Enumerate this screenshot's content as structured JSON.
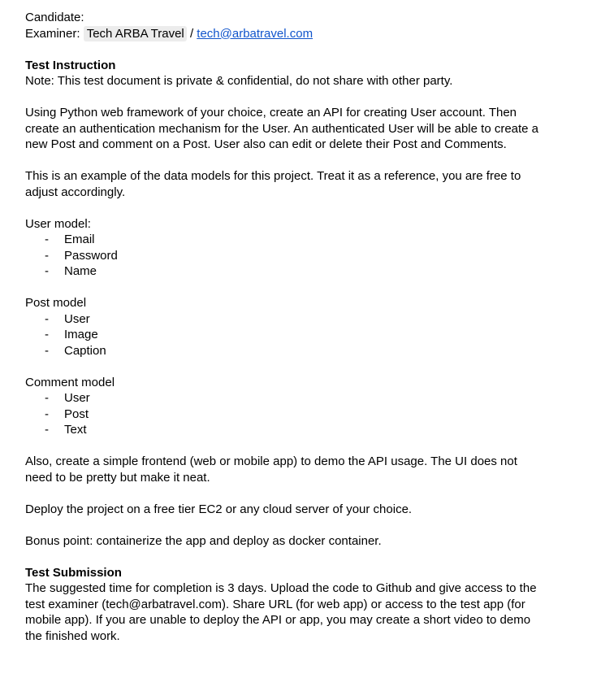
{
  "header": {
    "candidate_label": "Candidate:",
    "examiner_label": "Examiner:",
    "examiner_name": "Tech ARBA Travel",
    "separator": "/",
    "examiner_email": "tech@arbatravel.com"
  },
  "instruction": {
    "heading": "Test Instruction",
    "note": "Note: This test document is private & confidential, do not share with other party.",
    "intro": "Using Python web framework of your choice, create an API for creating User account. Then create an authentication mechanism for the User. An authenticated User will be able to create a new Post and comment on a Post. User also can edit or delete their Post and Comments.",
    "models_intro": "This is an example of the data models for this project. Treat it as a reference, you are free to adjust accordingly."
  },
  "models": [
    {
      "title": "User model:",
      "fields": [
        "Email",
        "Password",
        "Name"
      ]
    },
    {
      "title": "Post model",
      "fields": [
        "User",
        "Image",
        "Caption"
      ]
    },
    {
      "title": "Comment model",
      "fields": [
        "User",
        "Post",
        "Text"
      ]
    }
  ],
  "bullet_char": "-",
  "requirements": {
    "frontend": "Also, create a simple frontend (web or mobile app) to demo the API usage. The UI does not need to be pretty but make it neat.",
    "deploy": "Deploy the project on a free tier EC2 or any cloud server of your choice.",
    "bonus": "Bonus point: containerize the app and deploy as docker container."
  },
  "submission": {
    "heading": "Test Submission",
    "body": "The suggested time for completion is 3 days. Upload the code to Github and give access to the test examiner (tech@arbatravel.com). Share URL (for web app) or access to the test app (for mobile app). If you are unable to deploy the API or app, you may create a short video to demo the finished work."
  },
  "colors": {
    "link": "#1155cc",
    "chip_bg": "#ececec",
    "text": "#000000"
  }
}
